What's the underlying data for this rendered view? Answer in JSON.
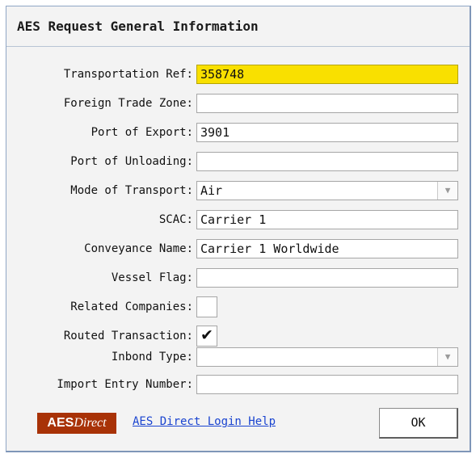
{
  "dialog": {
    "title": "AES Request General Information"
  },
  "form": {
    "transportation_ref": {
      "label": "Transportation Ref:",
      "value": "358748"
    },
    "foreign_trade_zone": {
      "label": "Foreign Trade Zone:",
      "value": ""
    },
    "port_of_export": {
      "label": "Port of Export:",
      "value": "3901"
    },
    "port_of_unloading": {
      "label": "Port of Unloading:",
      "value": ""
    },
    "mode_of_transport": {
      "label": "Mode of Transport:",
      "value": "Air"
    },
    "scac": {
      "label": "SCAC:",
      "value": "Carrier 1"
    },
    "conveyance_name": {
      "label": "Conveyance Name:",
      "value": "Carrier 1 Worldwide"
    },
    "vessel_flag": {
      "label": "Vessel Flag:",
      "value": ""
    },
    "related_companies": {
      "label": "Related Companies:",
      "checked": false,
      "mark": ""
    },
    "routed_transaction": {
      "label": "Routed Transaction:",
      "checked": true,
      "mark": "✔"
    },
    "inbond_type": {
      "label": "Inbond Type:",
      "value": ""
    },
    "import_entry_number": {
      "label": "Import Entry Number:",
      "value": ""
    }
  },
  "footer": {
    "logo_bold": "AES",
    "logo_italic": "Direct",
    "help_link": "AES Direct Login Help",
    "ok_label": "OK"
  },
  "colors": {
    "highlight_field": "#f9e000",
    "logo_bg": "#a83207",
    "link": "#1a44d0"
  }
}
